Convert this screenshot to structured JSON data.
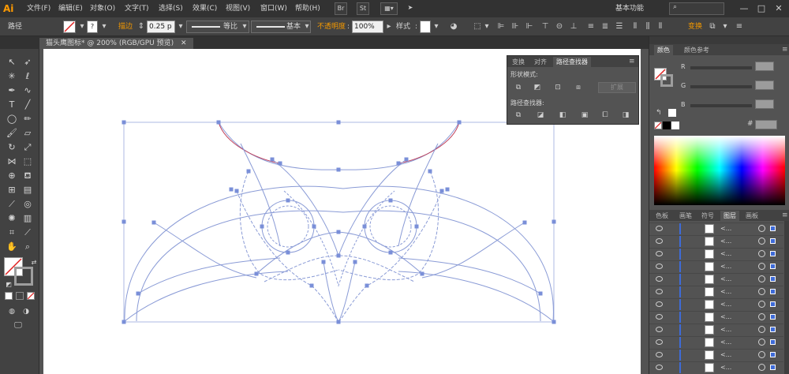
{
  "app": {
    "logo": "Ai"
  },
  "menu": [
    "文件(F)",
    "编辑(E)",
    "对象(O)",
    "文字(T)",
    "选择(S)",
    "效果(C)",
    "视图(V)",
    "窗口(W)",
    "帮助(H)"
  ],
  "menubar_extras": {
    "br_label": "Br",
    "st_label": "St",
    "workspace": "基本功能"
  },
  "window_controls": {
    "minimize": "—",
    "maximize": "□",
    "close": "✕"
  },
  "control_bar": {
    "selection_label": "路径",
    "stroke_label": "描边",
    "stroke_value": "0.25 p",
    "profile_label": "等比",
    "brush_label": "基本",
    "opacity_label": "不透明度",
    "opacity_value": "100%",
    "style_label": "样式",
    "transform_label": "变换"
  },
  "document_tab": {
    "title": "猫头鹰图标* @ 200% (RGB/GPU 预览)",
    "close": "✕"
  },
  "pathfinder_panel": {
    "tabs": [
      "变换",
      "对齐",
      "路径查找器"
    ],
    "active_tab": "路径查找器",
    "shape_modes_label": "形状模式:",
    "expand_button": "扩展",
    "pathfinders_label": "路径查找器:"
  },
  "color_panel": {
    "tabs": [
      "颜色",
      "颜色参考"
    ],
    "active_tab": "颜色",
    "channels": [
      "R",
      "G",
      "B"
    ],
    "hex_label": "#"
  },
  "layers_panel": {
    "tabs": [
      "色板",
      "画笔",
      "符号",
      "图层",
      "画板"
    ],
    "active_tab": "图层",
    "row_name": "<...",
    "row_count": 12
  },
  "colors": {
    "accent": "#3e6bd8",
    "path_stroke": "#8a9bd6",
    "path_red": "#c0405a",
    "warning": "#f39800"
  }
}
